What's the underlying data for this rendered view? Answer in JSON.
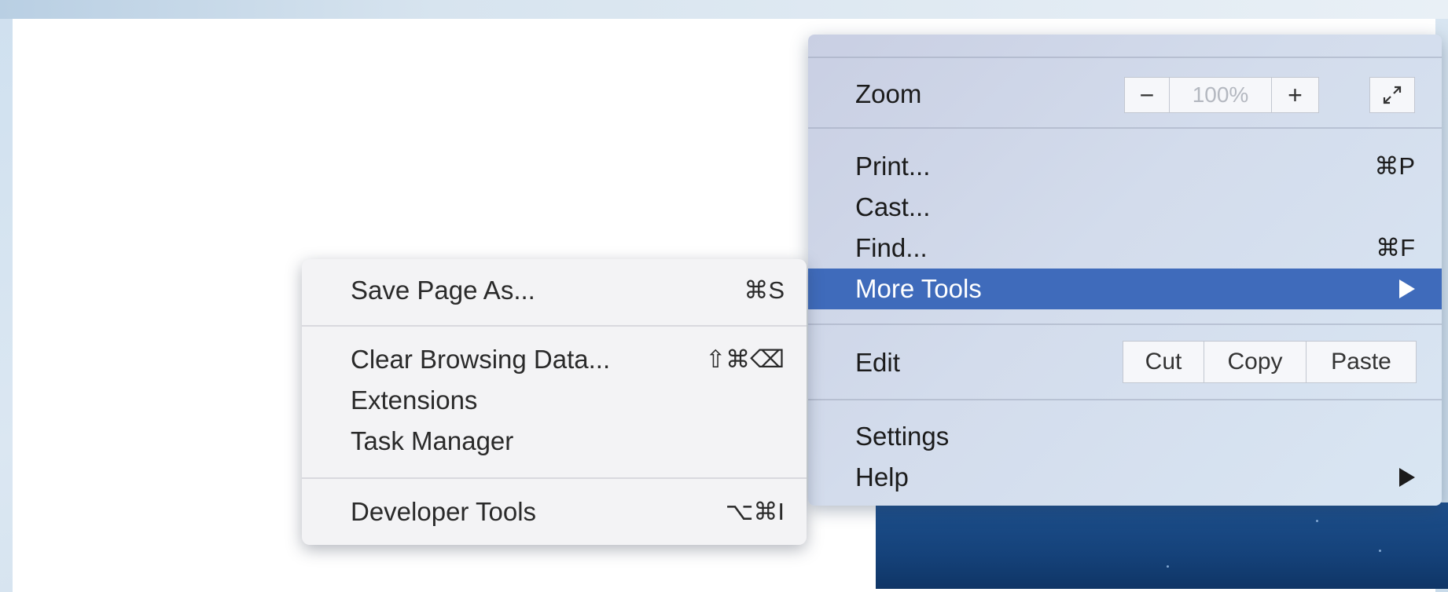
{
  "main_menu": {
    "zoom": {
      "label": "Zoom",
      "minus": "−",
      "value": "100%",
      "plus": "+",
      "fullscreen_icon": "fullscreen-icon"
    },
    "items": [
      {
        "label": "Print...",
        "shortcut": "⌘P"
      },
      {
        "label": "Cast...",
        "shortcut": ""
      },
      {
        "label": "Find...",
        "shortcut": "⌘F"
      },
      {
        "label": "More Tools",
        "shortcut": ""
      }
    ],
    "edit": {
      "label": "Edit",
      "cut": "Cut",
      "copy": "Copy",
      "paste": "Paste"
    },
    "settings": "Settings",
    "help": "Help"
  },
  "more_tools_submenu": {
    "items": [
      {
        "label": "Save Page As...",
        "shortcut": "⌘S"
      },
      {
        "label": "Clear Browsing Data...",
        "shortcut": "⇧⌘⌫"
      },
      {
        "label": "Extensions",
        "shortcut": ""
      },
      {
        "label": "Task Manager",
        "shortcut": ""
      },
      {
        "label": "Developer Tools",
        "shortcut": "⌥⌘I"
      }
    ]
  },
  "colors": {
    "highlight": "#3f6bbb",
    "menu_bg": "#d3dcec",
    "submenu_bg": "#f3f3f5"
  }
}
